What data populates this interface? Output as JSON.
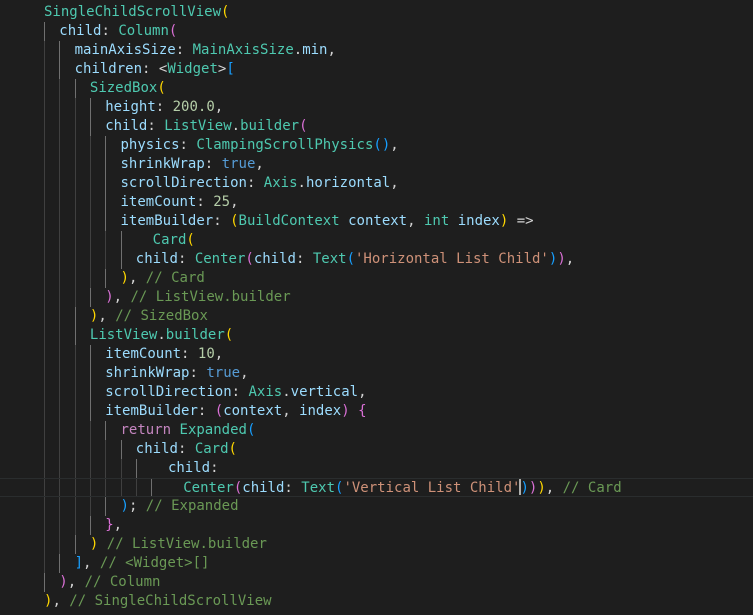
{
  "editor": {
    "language": "dart",
    "colors": {
      "background": "#1e1e1e",
      "class": "#4ec9b0",
      "property": "#9cdcfe",
      "number": "#b5cea8",
      "keyword": "#569cd6",
      "control": "#c586c0",
      "string": "#ce9178",
      "comment": "#6a9955",
      "text": "#d4d4d4"
    },
    "lines": [
      {
        "indent": 1,
        "tokens": [
          [
            "SingleChildScrollView",
            "cls"
          ],
          [
            "(",
            "br-y"
          ]
        ]
      },
      {
        "indent": 2,
        "tokens": [
          [
            "child",
            "id"
          ],
          [
            ": ",
            "txt"
          ],
          [
            "Column",
            "cls"
          ],
          [
            "(",
            "br-p"
          ]
        ]
      },
      {
        "indent": 3,
        "tokens": [
          [
            "mainAxisSize",
            "id"
          ],
          [
            ": ",
            "txt"
          ],
          [
            "MainAxisSize",
            "cls"
          ],
          [
            ".",
            "txt"
          ],
          [
            "min",
            "id"
          ],
          [
            ",",
            "txt"
          ]
        ]
      },
      {
        "indent": 3,
        "tokens": [
          [
            "children",
            "id"
          ],
          [
            ": <",
            "txt"
          ],
          [
            "Widget",
            "cls"
          ],
          [
            ">",
            "txt"
          ],
          [
            "[",
            "br-b"
          ]
        ]
      },
      {
        "indent": 4,
        "tokens": [
          [
            "SizedBox",
            "cls"
          ],
          [
            "(",
            "br-y"
          ]
        ]
      },
      {
        "indent": 5,
        "tokens": [
          [
            "height",
            "id"
          ],
          [
            ": ",
            "txt"
          ],
          [
            "200.0",
            "num"
          ],
          [
            ",",
            "txt"
          ]
        ]
      },
      {
        "indent": 5,
        "tokens": [
          [
            "child",
            "id"
          ],
          [
            ": ",
            "txt"
          ],
          [
            "ListView",
            "cls"
          ],
          [
            ".",
            "txt"
          ],
          [
            "builder",
            "cls"
          ],
          [
            "(",
            "br-p"
          ]
        ]
      },
      {
        "indent": 6,
        "tokens": [
          [
            "physics",
            "id"
          ],
          [
            ": ",
            "txt"
          ],
          [
            "ClampingScrollPhysics",
            "cls"
          ],
          [
            "(",
            "br-b"
          ],
          [
            ")",
            "br-b"
          ],
          [
            ",",
            "txt"
          ]
        ]
      },
      {
        "indent": 6,
        "tokens": [
          [
            "shrinkWrap",
            "id"
          ],
          [
            ": ",
            "txt"
          ],
          [
            "true",
            "kw"
          ],
          [
            ",",
            "txt"
          ]
        ]
      },
      {
        "indent": 6,
        "tokens": [
          [
            "scrollDirection",
            "id"
          ],
          [
            ": ",
            "txt"
          ],
          [
            "Axis",
            "cls"
          ],
          [
            ".",
            "txt"
          ],
          [
            "horizontal",
            "id"
          ],
          [
            ",",
            "txt"
          ]
        ]
      },
      {
        "indent": 6,
        "tokens": [
          [
            "itemCount",
            "id"
          ],
          [
            ": ",
            "txt"
          ],
          [
            "25",
            "num"
          ],
          [
            ",",
            "txt"
          ]
        ]
      },
      {
        "indent": 6,
        "tokens": [
          [
            "itemBuilder",
            "id"
          ],
          [
            ": ",
            "txt"
          ],
          [
            "(",
            "br-y"
          ],
          [
            "BuildContext",
            "cls"
          ],
          [
            " ",
            "txt"
          ],
          [
            "context",
            "id"
          ],
          [
            ", ",
            "txt"
          ],
          [
            "int",
            "cls"
          ],
          [
            " ",
            "txt"
          ],
          [
            "index",
            "id"
          ],
          [
            ")",
            "br-y"
          ],
          [
            " =>",
            "txt"
          ]
        ]
      },
      {
        "indent": 7,
        "tokens": [
          [
            "  Card",
            "cls"
          ],
          [
            "(",
            "br-y"
          ]
        ]
      },
      {
        "indent": 7,
        "tokens": [
          [
            "child",
            "id"
          ],
          [
            ": ",
            "txt"
          ],
          [
            "Center",
            "cls"
          ],
          [
            "(",
            "br-p"
          ],
          [
            "child",
            "id"
          ],
          [
            ": ",
            "txt"
          ],
          [
            "Text",
            "cls"
          ],
          [
            "(",
            "br-b"
          ],
          [
            "'Horizontal List Child'",
            "str"
          ],
          [
            ")",
            "br-b"
          ],
          [
            ")",
            "br-p"
          ],
          [
            ",",
            "txt"
          ]
        ]
      },
      {
        "indent": 6,
        "tokens": [
          [
            ")",
            "br-y"
          ],
          [
            ", ",
            "txt"
          ],
          [
            "// Card",
            "com"
          ]
        ]
      },
      {
        "indent": 5,
        "tokens": [
          [
            ")",
            "br-p"
          ],
          [
            ", ",
            "txt"
          ],
          [
            "// ListView.builder",
            "com"
          ]
        ]
      },
      {
        "indent": 4,
        "tokens": [
          [
            ")",
            "br-y"
          ],
          [
            ", ",
            "txt"
          ],
          [
            "// SizedBox",
            "com"
          ]
        ]
      },
      {
        "indent": 4,
        "tokens": [
          [
            "ListView",
            "cls"
          ],
          [
            ".",
            "txt"
          ],
          [
            "builder",
            "cls"
          ],
          [
            "(",
            "br-y"
          ]
        ]
      },
      {
        "indent": 5,
        "tokens": [
          [
            "itemCount",
            "id"
          ],
          [
            ": ",
            "txt"
          ],
          [
            "10",
            "num"
          ],
          [
            ",",
            "txt"
          ]
        ]
      },
      {
        "indent": 5,
        "tokens": [
          [
            "shrinkWrap",
            "id"
          ],
          [
            ": ",
            "txt"
          ],
          [
            "true",
            "kw"
          ],
          [
            ",",
            "txt"
          ]
        ]
      },
      {
        "indent": 5,
        "tokens": [
          [
            "scrollDirection",
            "id"
          ],
          [
            ": ",
            "txt"
          ],
          [
            "Axis",
            "cls"
          ],
          [
            ".",
            "txt"
          ],
          [
            "vertical",
            "id"
          ],
          [
            ",",
            "txt"
          ]
        ]
      },
      {
        "indent": 5,
        "tokens": [
          [
            "itemBuilder",
            "id"
          ],
          [
            ": ",
            "txt"
          ],
          [
            "(",
            "br-p"
          ],
          [
            "context",
            "id"
          ],
          [
            ", ",
            "txt"
          ],
          [
            "index",
            "id"
          ],
          [
            ")",
            "br-p"
          ],
          [
            " ",
            "txt"
          ],
          [
            "{",
            "br-p"
          ]
        ]
      },
      {
        "indent": 6,
        "tokens": [
          [
            "return",
            "ctl"
          ],
          [
            " ",
            "txt"
          ],
          [
            "Expanded",
            "cls"
          ],
          [
            "(",
            "br-b"
          ]
        ]
      },
      {
        "indent": 7,
        "tokens": [
          [
            "child",
            "id"
          ],
          [
            ": ",
            "txt"
          ],
          [
            "Card",
            "cls"
          ],
          [
            "(",
            "br-y"
          ]
        ]
      },
      {
        "indent": 8,
        "tokens": [
          [
            "  child",
            "id"
          ],
          [
            ":",
            "txt"
          ]
        ]
      },
      {
        "indent": 9,
        "tokens": [
          [
            "  Center",
            "cls"
          ],
          [
            "(",
            "br-p"
          ],
          [
            "child",
            "id"
          ],
          [
            ": ",
            "txt"
          ],
          [
            "Text",
            "cls"
          ],
          [
            "(",
            "br-b"
          ],
          [
            "'Vertical List Child'",
            "str"
          ],
          [
            "|cursor|",
            "cursor"
          ],
          [
            ")",
            "br-b"
          ],
          [
            ")",
            "br-p"
          ],
          [
            ")",
            "br-y"
          ],
          [
            ", ",
            "txt"
          ],
          [
            "// Card",
            "com"
          ]
        ],
        "current": true
      },
      {
        "indent": 6,
        "tokens": [
          [
            ")",
            "br-b"
          ],
          [
            "; ",
            "txt"
          ],
          [
            "// Expanded",
            "com"
          ]
        ]
      },
      {
        "indent": 5,
        "tokens": [
          [
            "}",
            "br-p"
          ],
          [
            ",",
            "txt"
          ]
        ]
      },
      {
        "indent": 4,
        "tokens": [
          [
            ")",
            "br-y"
          ],
          [
            " ",
            "txt"
          ],
          [
            "// ListView.builder",
            "com"
          ]
        ]
      },
      {
        "indent": 3,
        "tokens": [
          [
            "]",
            "br-b"
          ],
          [
            ", ",
            "txt"
          ],
          [
            "// <Widget>[]",
            "com"
          ]
        ]
      },
      {
        "indent": 2,
        "tokens": [
          [
            ")",
            "br-p"
          ],
          [
            ", ",
            "txt"
          ],
          [
            "// Column",
            "com"
          ]
        ]
      },
      {
        "indent": 1,
        "tokens": [
          [
            ")",
            "br-y"
          ],
          [
            ", ",
            "txt"
          ],
          [
            "// SingleChildScrollView",
            "com"
          ]
        ]
      }
    ]
  }
}
